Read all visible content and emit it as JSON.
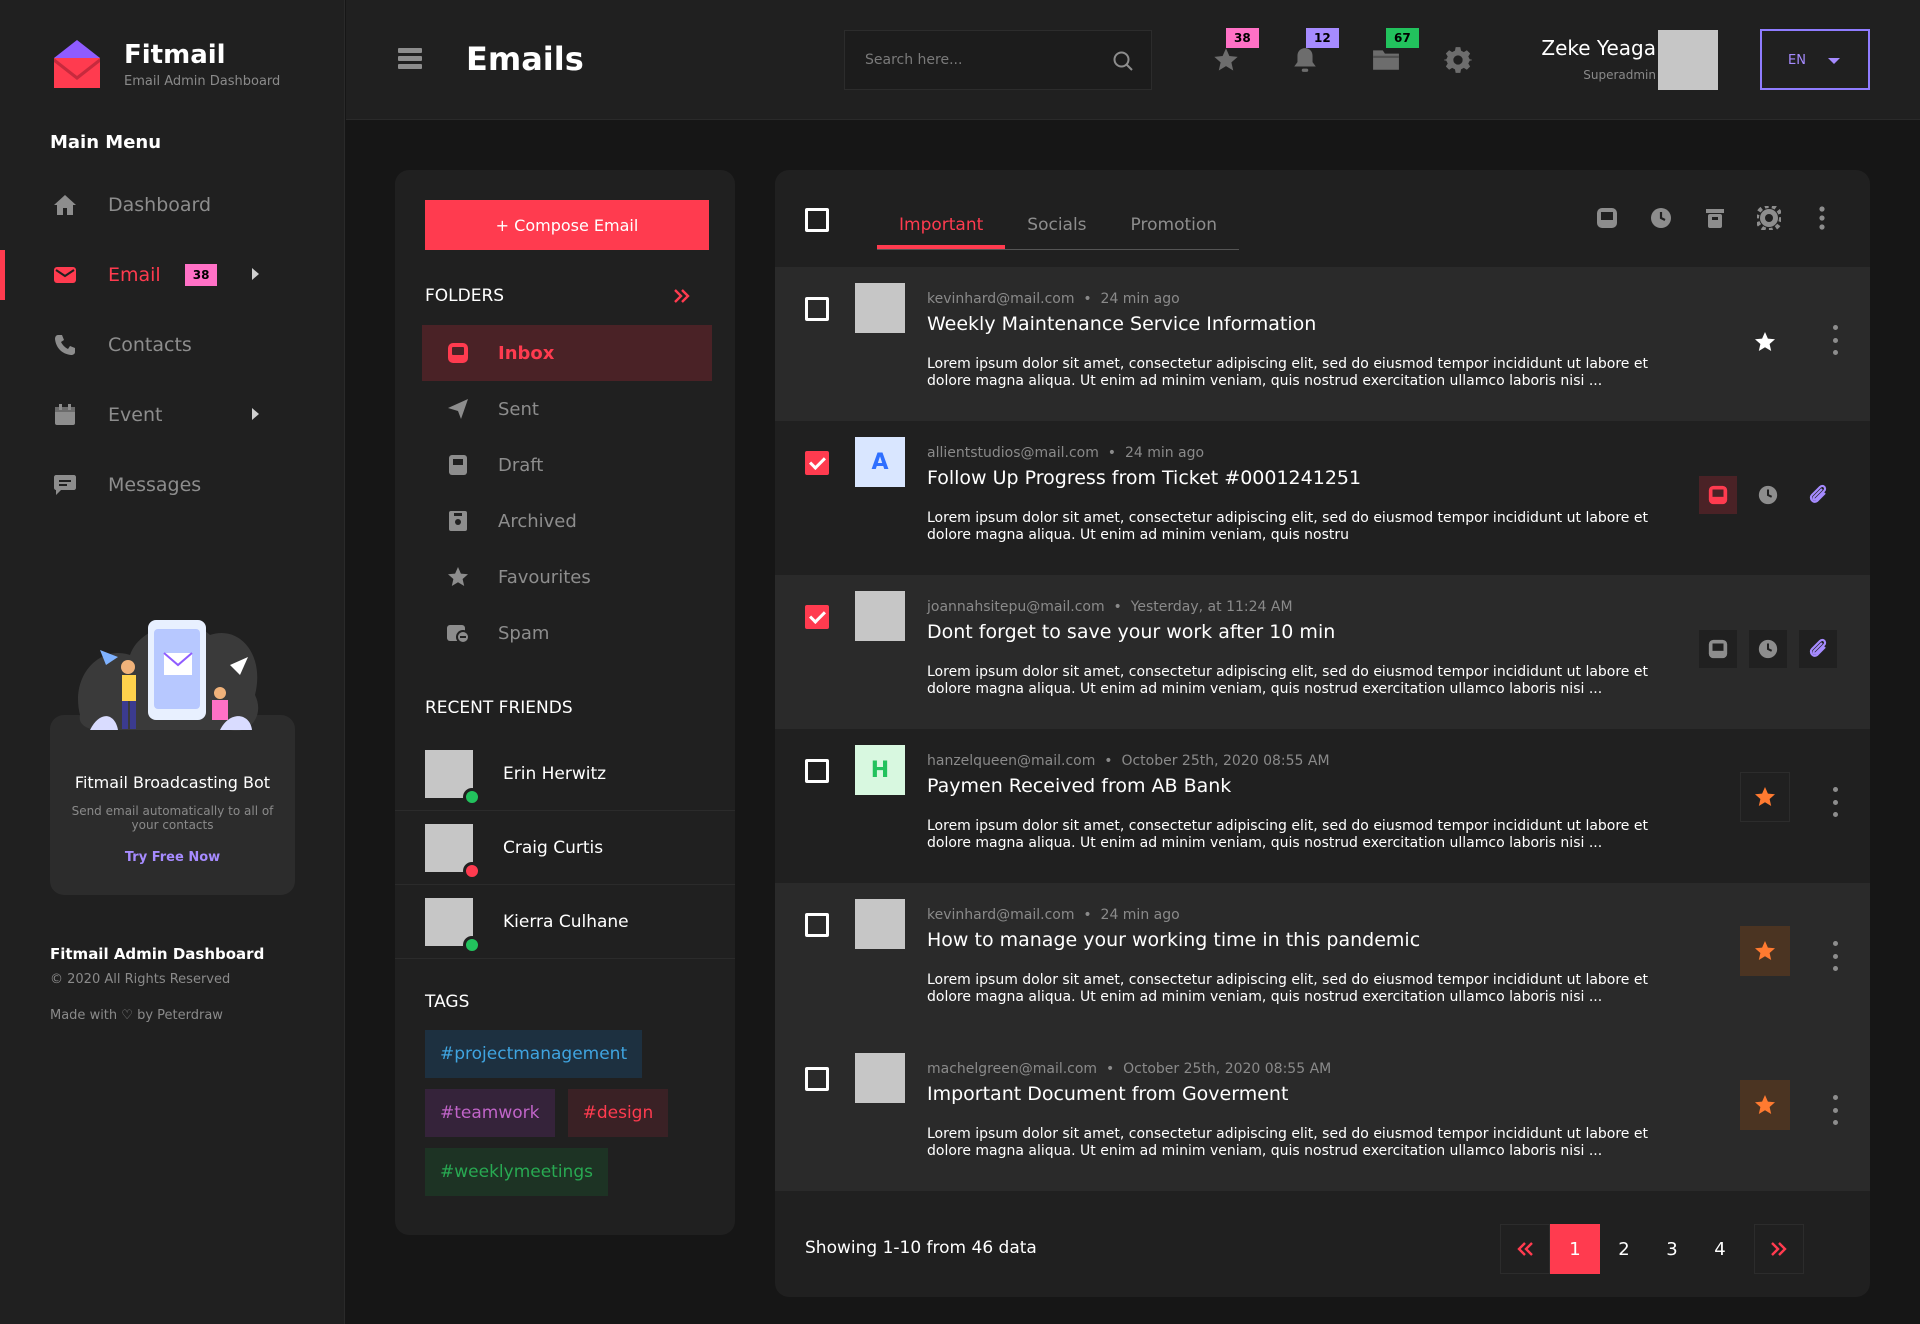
{
  "brand": {
    "name": "Fitmail",
    "subtitle": "Email Admin Dashboard"
  },
  "menu": {
    "title": "Main Menu",
    "items": [
      {
        "label": "Dashboard",
        "icon": "home-icon"
      },
      {
        "label": "Email",
        "icon": "mail-icon",
        "badge": "38",
        "active": true
      },
      {
        "label": "Contacts",
        "icon": "phone-icon"
      },
      {
        "label": "Event",
        "icon": "calendar-icon"
      },
      {
        "label": "Messages",
        "icon": "chat-icon"
      }
    ]
  },
  "promo": {
    "title": "Fitmail Broadcasting Bot",
    "text": "Send email automatically to all of your contacts",
    "link": "Try Free Now"
  },
  "footer": {
    "title": "Fitmail Admin Dashboard",
    "copyright": "© 2020 All Rights Reserved",
    "made_with": "Made with ♡ by Peterdraw"
  },
  "header": {
    "title": "Emails",
    "search_placeholder": "Search here...",
    "badges": {
      "star": "38",
      "bell": "12",
      "folder": "67"
    },
    "user_name": "Zeke Yeaga",
    "user_role": "Superadmin",
    "language": "EN"
  },
  "folders": {
    "compose_label": "+ Compose Email",
    "title": "FOLDERS",
    "items": [
      {
        "label": "Inbox",
        "active": true
      },
      {
        "label": "Sent"
      },
      {
        "label": "Draft"
      },
      {
        "label": "Archived"
      },
      {
        "label": "Favourites"
      },
      {
        "label": "Spam"
      }
    ]
  },
  "friends": {
    "title": "RECENT FRIENDS",
    "items": [
      {
        "name": "Erin Herwitz",
        "status": "online"
      },
      {
        "name": "Craig Curtis",
        "status": "busy"
      },
      {
        "name": "Kierra Culhane",
        "status": "online"
      }
    ]
  },
  "tags": {
    "title": "TAGS",
    "items": [
      "#projectmanagement",
      "#teamwork",
      "#design",
      "#weeklymeetings"
    ]
  },
  "mail": {
    "tabs": [
      "Important",
      "Socials",
      "Promotion"
    ],
    "emails": [
      {
        "from": "kevinhard@mail.com",
        "time": "24 min ago",
        "subject": "Weekly Maintenance Service Information",
        "body": "Lorem ipsum dolor sit amet, consectetur adipiscing elit, sed do eiusmod tempor incididunt ut labore et dolore magna aliqua. Ut enim ad minim veniam, quis nostrud exercitation ullamco laboris nisi ..."
      },
      {
        "from": "allientstudios@mail.com",
        "time": "24 min ago",
        "subject": "Follow Up Progress from Ticket #0001241251",
        "body": "Lorem ipsum dolor sit amet, consectetur adipiscing elit, sed do eiusmod tempor incididunt ut labore et dolore magna aliqua. Ut enim ad minim veniam, quis nostru",
        "avatar_letter": "A"
      },
      {
        "from": "joannahsitepu@mail.com",
        "time": "Yesterday, at 11:24 AM",
        "subject": "Dont forget to save your work after 10 min",
        "body": "Lorem ipsum dolor sit amet, consectetur adipiscing elit, sed do eiusmod tempor incididunt ut labore et dolore magna aliqua. Ut enim ad minim veniam, quis nostrud exercitation ullamco laboris nisi ..."
      },
      {
        "from": "hanzelqueen@mail.com",
        "time": "October 25th, 2020  08:55 AM",
        "subject": "Paymen Received from AB Bank",
        "body": "Lorem ipsum dolor sit amet, consectetur adipiscing elit, sed do eiusmod tempor incididunt ut labore et dolore magna aliqua. Ut enim ad minim veniam, quis nostrud exercitation ullamco laboris nisi ...",
        "avatar_letter": "H"
      },
      {
        "from": "kevinhard@mail.com",
        "time": "24 min ago",
        "subject": "How to manage your working time in this pandemic",
        "body": "Lorem ipsum dolor sit amet, consectetur adipiscing elit, sed do eiusmod tempor incididunt ut labore et dolore magna aliqua. Ut enim ad minim veniam, quis nostrud exercitation ullamco laboris nisi ..."
      },
      {
        "from": "machelgreen@mail.com",
        "time": "October 25th, 2020  08:55 AM",
        "subject": "Important Document from Goverment",
        "body": "Lorem ipsum dolor sit amet, consectetur adipiscing elit, sed do eiusmod tempor incididunt ut labore et dolore magna aliqua. Ut enim ad minim veniam, quis nostrud exercitation ullamco laboris nisi ..."
      }
    ],
    "pagination_info": "Showing 1-10 from 46 data",
    "pages": [
      "1",
      "2",
      "3",
      "4"
    ]
  },
  "colors": {
    "accent": "#ff3b4f",
    "purple": "#a68bff",
    "orange": "#ff7a30"
  }
}
